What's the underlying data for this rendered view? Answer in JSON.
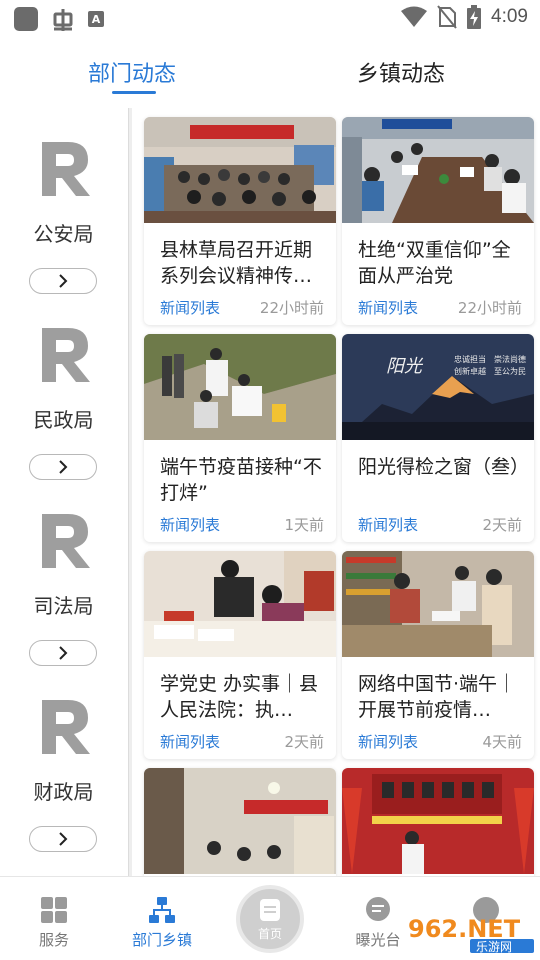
{
  "status_bar": {
    "time": "4:09",
    "icons": [
      "app-square-icon",
      "bug-icon",
      "a-box-icon",
      "wifi-icon",
      "no-sim-icon",
      "battery-charging-icon"
    ]
  },
  "tabs": [
    {
      "label": "部门动态",
      "active": true
    },
    {
      "label": "乡镇动态",
      "active": false
    }
  ],
  "sidebar": {
    "departments": [
      {
        "name": "公安局",
        "icon": "r-logo-icon"
      },
      {
        "name": "民政局",
        "icon": "r-logo-icon"
      },
      {
        "name": "司法局",
        "icon": "r-logo-icon"
      },
      {
        "name": "财政局",
        "icon": "r-logo-icon"
      }
    ]
  },
  "news": [
    {
      "title": "县林草局召开近期系列会议精神传…",
      "category": "新闻列表",
      "time": "22小时前",
      "image": "meeting-hall-photo"
    },
    {
      "title": "杜绝“双重信仰”全面从严治党",
      "category": "新闻列表",
      "time": "22小时前",
      "image": "meeting-table-photo"
    },
    {
      "title": "端午节疫苗接种“不打烊”",
      "category": "新闻列表",
      "time": "1天前",
      "image": "vaccination-photo"
    },
    {
      "title": "阳光得检之窗（叁）",
      "category": "新闻列表",
      "time": "2天前",
      "image": "mountain-banner-photo"
    },
    {
      "title": "学党史 办实事｜县人民法院：执…",
      "category": "新闻列表",
      "time": "2天前",
      "image": "signing-documents-photo"
    },
    {
      "title": "网络中国节·端午｜开展节前疫情…",
      "category": "新闻列表",
      "time": "4天前",
      "image": "shop-inspection-photo"
    },
    {
      "title": "",
      "category": "",
      "time": "",
      "image": "classroom-photo"
    },
    {
      "title": "",
      "category": "",
      "time": "",
      "image": "stage-speech-photo"
    }
  ],
  "image_text": {
    "banner_line1": "忠诚担当　崇法尚德",
    "banner_line2": "创新卓越　至公为民",
    "banner_script": "阳光"
  },
  "bottom_nav": [
    {
      "label": "服务",
      "icon": "grid-icon",
      "active": false
    },
    {
      "label": "部门乡镇",
      "icon": "org-chart-icon",
      "active": true
    },
    {
      "label": "首页",
      "icon": "home-doc-icon",
      "active": false
    },
    {
      "label": "曝光台",
      "icon": "speech-bubble-icon",
      "active": false
    },
    {
      "label": "",
      "icon": "more-icon",
      "active": false
    }
  ],
  "watermark": {
    "line1": "962.NET",
    "line2": "乐游网"
  },
  "colors": {
    "accent": "#2a7ad6",
    "muted": "#9a9a9a",
    "logo": "#9e9e9e"
  }
}
